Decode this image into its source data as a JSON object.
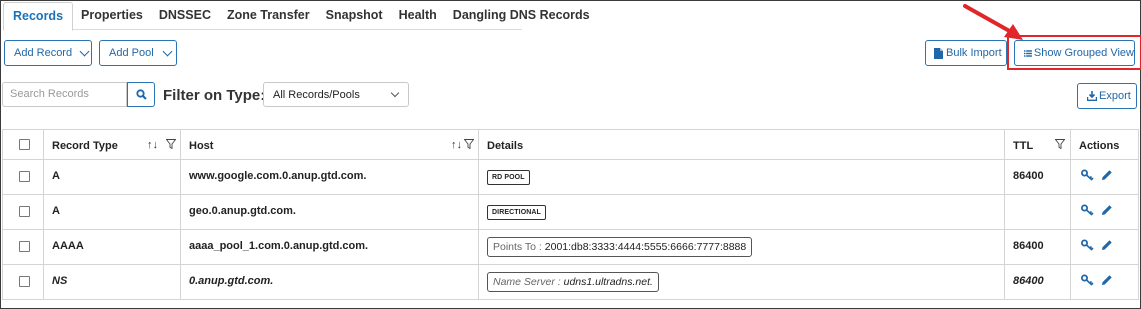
{
  "tabs": [
    {
      "label": "Records",
      "active": true
    },
    {
      "label": "Properties"
    },
    {
      "label": "DNSSEC"
    },
    {
      "label": "Zone Transfer"
    },
    {
      "label": "Snapshot"
    },
    {
      "label": "Health"
    },
    {
      "label": "Dangling DNS Records"
    }
  ],
  "toolbar": {
    "add_record": "Add Record",
    "add_pool": "Add Pool",
    "bulk_import": "Bulk Import",
    "grouped_view": "Show Grouped View"
  },
  "search": {
    "placeholder": "Search Records"
  },
  "filter": {
    "label": "Filter on Type:",
    "selected": "All Records/Pools"
  },
  "export_label": "Export",
  "table": {
    "columns": [
      "Record Type",
      "Host",
      "Details",
      "TTL",
      "Actions"
    ],
    "rows": [
      {
        "type": "A",
        "host": "www.google.com.0.anup.gtd.com.",
        "detail_tag": "RD POOL",
        "ttl": "86400"
      },
      {
        "type": "A",
        "host": "geo.0.anup.gtd.com.",
        "detail_tag": "DIRECTIONAL",
        "ttl": ""
      },
      {
        "type": "AAAA",
        "host": "aaaa_pool_1.com.0.anup.gtd.com.",
        "detail_label": "Points To :",
        "detail_value": "2001:db8:3333:4444:5555:6666:7777:8888",
        "ttl": "86400"
      },
      {
        "type": "NS",
        "host": "0.anup.gtd.com.",
        "detail_label": "Name Server :",
        "detail_value": "udns1.ultradns.net.",
        "ttl": "86400"
      }
    ]
  },
  "colors": {
    "accent": "#1f67a8",
    "highlight": "#e0262a"
  }
}
